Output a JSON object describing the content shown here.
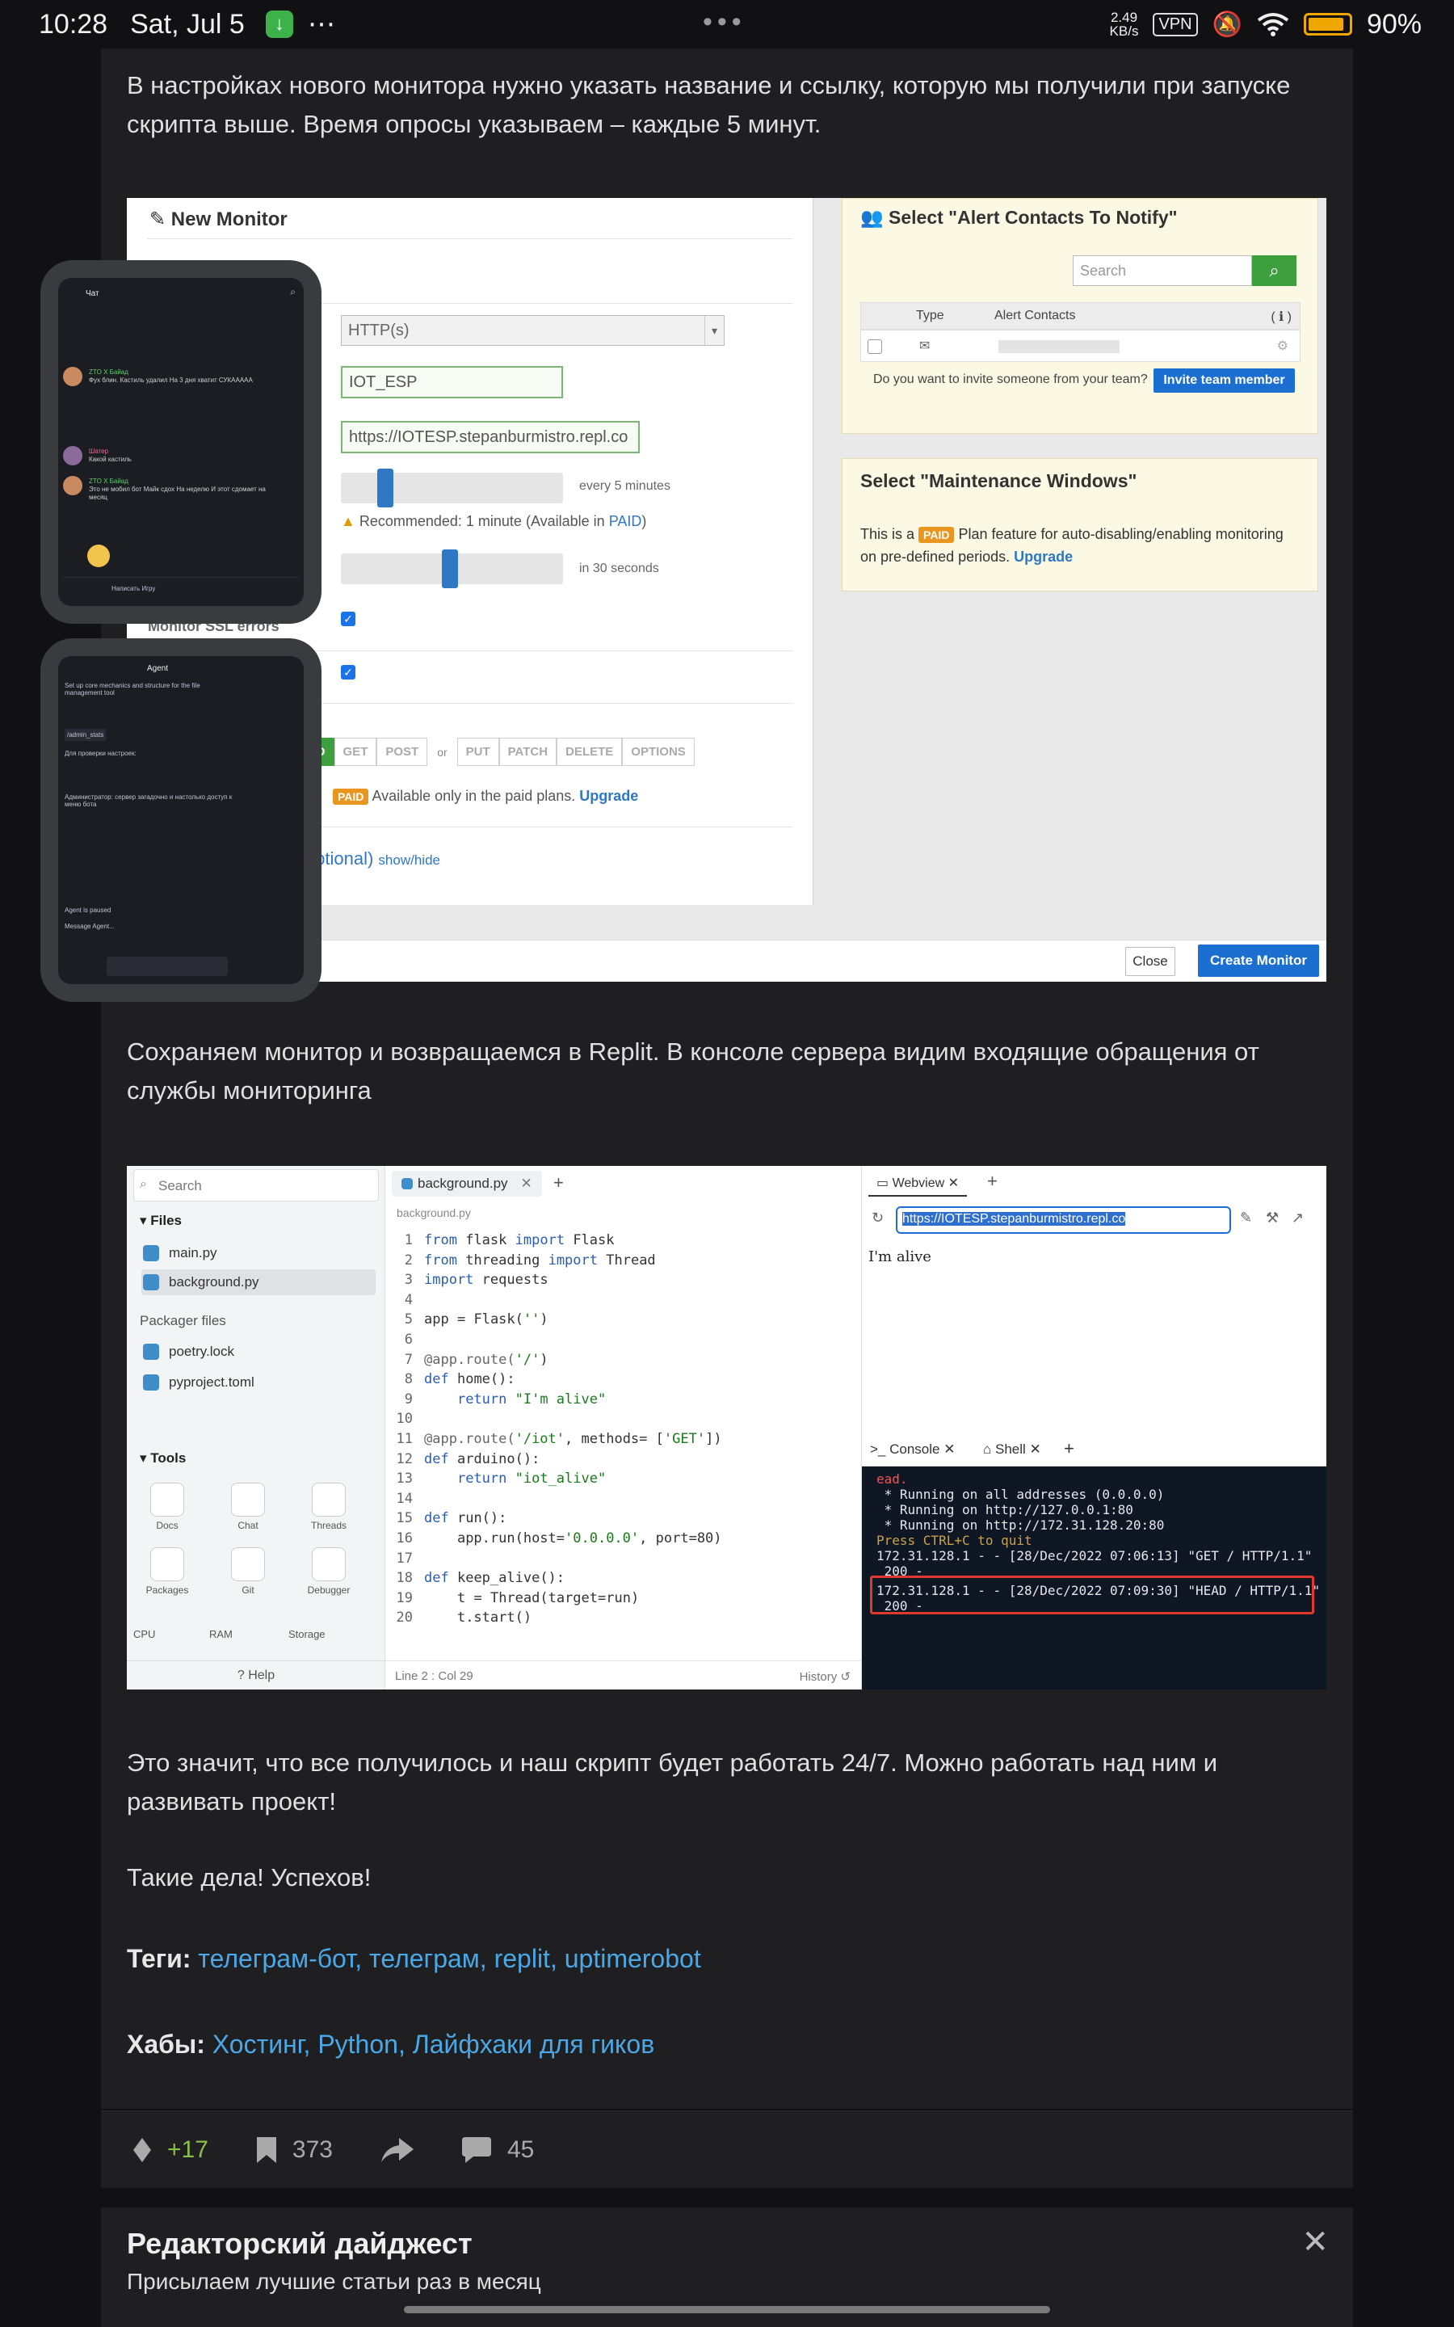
{
  "status_bar": {
    "time": "10:28",
    "date": "Sat, Jul 5",
    "more": "⋯",
    "center_dots": "•••",
    "speed": "2.49",
    "speed_unit": "KB/s",
    "vpn": "VPN",
    "battery": "90%",
    "battery_level": 0.9
  },
  "article": {
    "para1": "В настройках нового монитора нужно указать название и ссылку, которую мы получили при запуске скрипта выше. Время опросы указываем – каждые 5 минут.",
    "para2": "Сохраняем монитор и возвращаемся в Replit. В консоле сервера видим входящие обращения от службы мониторинга",
    "para3": "Это значит, что все получилось и наш скрипт будет работать 24/7. Можно работать над ним и развивать проект!",
    "para4": "Такие дела! Успехов!",
    "tags_label": "Теги:",
    "tags": "телеграм-бот, телеграм, replit, uptimerobot",
    "hubs_label": "Хабы:",
    "hubs": "Хостинг, Python, Лайфхаки для гиков"
  },
  "monitor": {
    "title": "New Monitor",
    "type_value": "HTTP(s)",
    "name_value": "IOT_ESP",
    "url_value": "https://IOTESP.stepanburmistro.repl.co",
    "interval_label": "every 5 minutes",
    "recommended": "Recommended: 1 minute (Available in ",
    "paid_link": "PAID",
    "recommended_end": ")",
    "timeout_label": "in 30 seconds",
    "ssl_label": "Monitor SSL errors",
    "methods": [
      "HEAD",
      "GET",
      "POST"
    ],
    "methods2": [
      "PUT",
      "PATCH",
      "DELETE",
      "OPTIONS"
    ],
    "or_label": "or",
    "paid_badge": "PAID",
    "paid_note": "Available only in the paid plans.",
    "upgrade": "Upgrade",
    "advanced": "ttings (Optional)",
    "show_hide": "show/hide",
    "alert_title": "Select \"Alert Contacts To Notify\"",
    "search_placeholder": "Search",
    "col_type": "Type",
    "col_contacts": "Alert Contacts",
    "invite_q": "Do you want to invite someone from your team?",
    "invite_btn": "Invite team member",
    "maint_title": "Select \"Maintenance Windows\"",
    "maint_text_a": "This is a",
    "maint_text_b": "Plan feature for auto-disabling/enabling monitoring on pre-defined periods.",
    "close_btn": "Close",
    "create_btn": "Create Monitor"
  },
  "replit": {
    "search": "Search",
    "files_heading": "Files",
    "files": [
      "main.py",
      "background.py"
    ],
    "packager_heading": "Packager files",
    "packager_files": [
      "poetry.lock",
      "pyproject.toml"
    ],
    "tools_heading": "Tools",
    "tools": [
      "Docs",
      "Chat",
      "Threads",
      "Packages",
      "Git",
      "Debugger"
    ],
    "resources": [
      "CPU",
      "RAM",
      "Storage"
    ],
    "help": "Help",
    "tab": "background.py",
    "crumb": "background.py",
    "status": "Line 2 : Col 29",
    "history": "History",
    "code": [
      [
        "1",
        "from flask import Flask"
      ],
      [
        "2",
        "from threading import Thread"
      ],
      [
        "3",
        "import requests"
      ],
      [
        "4",
        ""
      ],
      [
        "5",
        "app = Flask('')"
      ],
      [
        "6",
        ""
      ],
      [
        "7",
        "@app.route('/')"
      ],
      [
        "8",
        "def home():"
      ],
      [
        "9",
        "    return \"I'm alive\""
      ],
      [
        "10",
        ""
      ],
      [
        "11",
        "@app.route('/iot', methods= ['GET'])"
      ],
      [
        "12",
        "def arduino():"
      ],
      [
        "13",
        "    return \"iot_alive\""
      ],
      [
        "14",
        ""
      ],
      [
        "15",
        "def run():"
      ],
      [
        "16",
        "    app.run(host='0.0.0.0', port=80)"
      ],
      [
        "17",
        ""
      ],
      [
        "18",
        "def keep_alive():"
      ],
      [
        "19",
        "    t = Thread(target=run)"
      ],
      [
        "20",
        "    t.start()"
      ]
    ],
    "webview_tab": "Webview",
    "webview_url": "https://IOTESP.stepanburmistro.repl.co",
    "webview_text": "I'm alive",
    "console_tab": "Console",
    "shell_tab": "Shell",
    "console_lines": [
      "ead.",
      " * Running on all addresses (0.0.0.0)",
      " * Running on http://127.0.0.1:80",
      " * Running on http://172.31.128.20:80",
      "Press CTRL+C to quit",
      "172.31.128.1 - - [28/Dec/2022 07:06:13] \"GET / HTTP/1.1\"",
      " 200 -",
      "172.31.128.1 - - [28/Dec/2022 07:09:30] \"HEAD / HTTP/1.1\"",
      " 200 -"
    ]
  },
  "floating": {
    "chat_title": "Чат",
    "chat_msgs": [
      {
        "who": "ZTO X Байад",
        "text": "Фух блин. Кастиль удалил На 3 дня хватит СУКААААА"
      },
      {
        "who": "Шатер",
        "text": "Какой кастиль"
      },
      {
        "who": "ZTO X Байад",
        "text": "Это не мобил бот Майк сдох На неделю И этот сдомает на месяц"
      }
    ],
    "chat_input": "Написать Игру",
    "agent_title": "Agent",
    "agent_lines": [
      "Set up core mechanics and structure for the file management tool",
      "/admin_stats",
      "Для проверки настроек:",
      "Администратор: сервер загадочно и настолько доступ к меню бота",
      "Agent is paused",
      "Message Agent..."
    ]
  },
  "reactions": {
    "votes": "+17",
    "bookmarks": "373",
    "comments": "45"
  },
  "digest": {
    "title": "Редакторский дайджест",
    "subtitle": "Присылаем лучшие статьи раз в месяц",
    "close": "✕"
  }
}
